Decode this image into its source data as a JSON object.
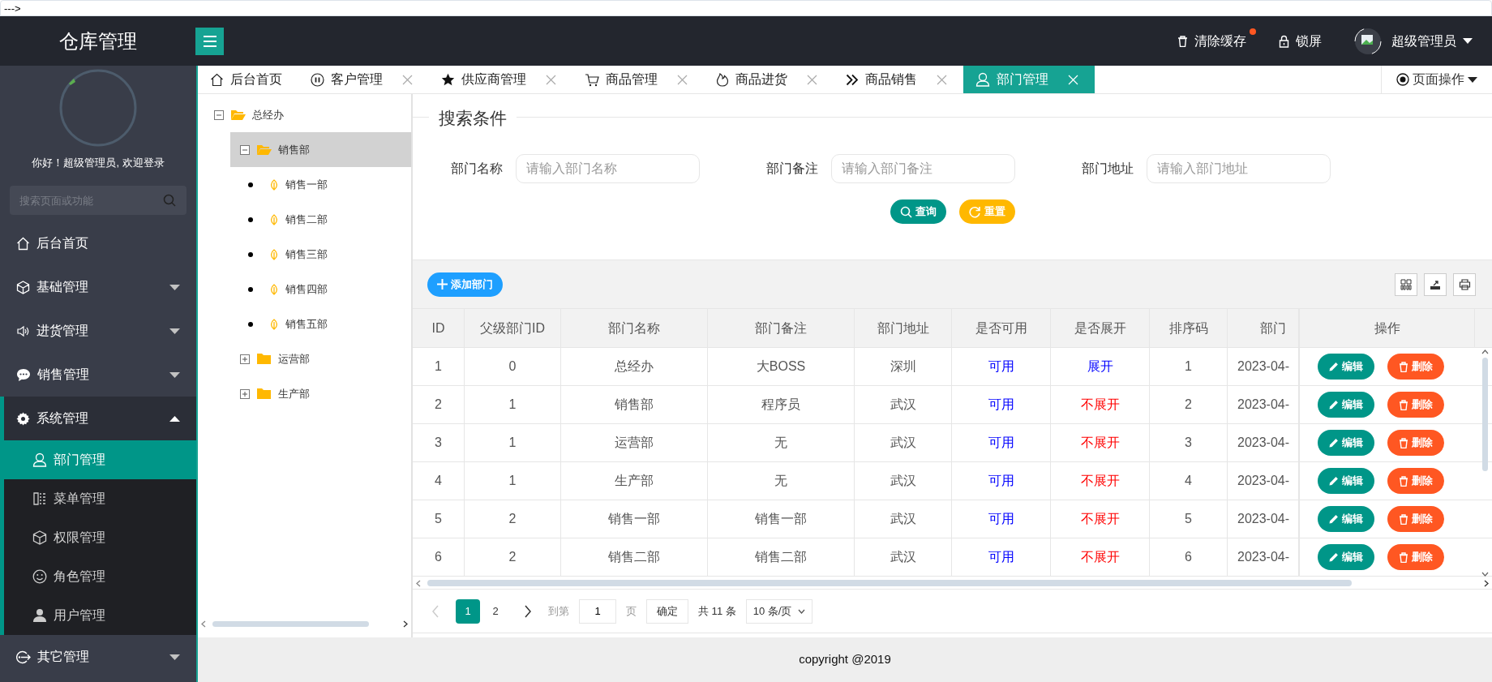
{
  "top_note": "--->",
  "header": {
    "logo": "仓库管理",
    "clear_cache": "清除缓存",
    "lock": "锁屏",
    "user": "超级管理员"
  },
  "sidebar": {
    "welcome": "你好！超级管理员, 欢迎登录",
    "search": {
      "placeholder": "搜索页面或功能"
    },
    "items": [
      {
        "kind": "link",
        "label": "后台首页"
      },
      {
        "kind": "group",
        "label": "基础管理",
        "expanded": false
      },
      {
        "kind": "group",
        "label": "进货管理",
        "expanded": false
      },
      {
        "kind": "group",
        "label": "销售管理",
        "expanded": false
      },
      {
        "kind": "group",
        "label": "系统管理",
        "expanded": true,
        "children": [
          {
            "label": "部门管理",
            "selected": true
          },
          {
            "label": "菜单管理",
            "selected": false
          },
          {
            "label": "权限管理",
            "selected": false
          },
          {
            "label": "角色管理",
            "selected": false
          },
          {
            "label": "用户管理",
            "selected": false
          }
        ]
      },
      {
        "kind": "group",
        "label": "其它管理",
        "expanded": false
      }
    ]
  },
  "tabs": [
    {
      "label": "后台首页",
      "selected": false,
      "closable": false
    },
    {
      "label": "客户管理",
      "selected": false,
      "closable": true
    },
    {
      "label": "供应商管理",
      "selected": false,
      "closable": true
    },
    {
      "label": "商品管理",
      "selected": false,
      "closable": true
    },
    {
      "label": "商品进货",
      "selected": false,
      "closable": true
    },
    {
      "label": "商品销售",
      "selected": false,
      "closable": true
    },
    {
      "label": "部门管理",
      "selected": true,
      "closable": true
    }
  ],
  "page_ops": "页面操作",
  "tree": [
    {
      "kind": "folder",
      "label": "总经办",
      "expanded": true,
      "selected": false,
      "children": [
        {
          "kind": "folder",
          "label": "销售部",
          "expanded": true,
          "selected": true,
          "children": [
            {
              "kind": "leaf",
              "label": "销售一部",
              "selected": false
            },
            {
              "kind": "leaf",
              "label": "销售二部",
              "selected": false
            },
            {
              "kind": "leaf",
              "label": "销售三部",
              "selected": false
            },
            {
              "kind": "leaf",
              "label": "销售四部",
              "selected": false
            },
            {
              "kind": "leaf",
              "label": "销售五部",
              "selected": false
            }
          ]
        },
        {
          "kind": "folder",
          "label": "运营部",
          "expanded": false,
          "selected": false
        },
        {
          "kind": "folder",
          "label": "生产部",
          "expanded": false,
          "selected": false
        }
      ]
    }
  ],
  "search": {
    "legend": "搜索条件",
    "fields": [
      {
        "label": "部门名称",
        "placeholder": "请输入部门名称"
      },
      {
        "label": "部门备注",
        "placeholder": "请输入部门备注"
      },
      {
        "label": "部门地址",
        "placeholder": "请输入部门地址"
      }
    ],
    "query_button": "查询",
    "reset_button": "重置"
  },
  "add_button": "添加部门",
  "table": {
    "columns": [
      "ID",
      "父级部门ID",
      "部门名称",
      "部门备注",
      "部门地址",
      "是否可用",
      "是否展开",
      "排序码",
      "部门",
      "操作"
    ],
    "rows": [
      {
        "id": "1",
        "pid": "0",
        "name": "总经办",
        "remark": "大BOSS",
        "address": "深圳",
        "available": "可用",
        "enabled": true,
        "open_text": "展开",
        "expanded": true,
        "order": "1",
        "created": "2023-04-",
        "edit": "编辑",
        "delete": "删除"
      },
      {
        "id": "2",
        "pid": "1",
        "name": "销售部",
        "remark": "程序员",
        "address": "武汉",
        "available": "可用",
        "enabled": true,
        "open_text": "不展开",
        "expanded": false,
        "order": "2",
        "created": "2023-04-",
        "edit": "编辑",
        "delete": "删除"
      },
      {
        "id": "3",
        "pid": "1",
        "name": "运营部",
        "remark": "无",
        "address": "武汉",
        "available": "可用",
        "enabled": true,
        "open_text": "不展开",
        "expanded": false,
        "order": "3",
        "created": "2023-04-",
        "edit": "编辑",
        "delete": "删除"
      },
      {
        "id": "4",
        "pid": "1",
        "name": "生产部",
        "remark": "无",
        "address": "武汉",
        "available": "可用",
        "enabled": true,
        "open_text": "不展开",
        "expanded": false,
        "order": "4",
        "created": "2023-04-",
        "edit": "编辑",
        "delete": "删除"
      },
      {
        "id": "5",
        "pid": "2",
        "name": "销售一部",
        "remark": "销售一部",
        "address": "武汉",
        "available": "可用",
        "enabled": true,
        "open_text": "不展开",
        "expanded": false,
        "order": "5",
        "created": "2023-04-",
        "edit": "编辑",
        "delete": "删除"
      },
      {
        "id": "6",
        "pid": "2",
        "name": "销售二部",
        "remark": "销售二部",
        "address": "武汉",
        "available": "可用",
        "enabled": true,
        "open_text": "不展开",
        "expanded": false,
        "order": "6",
        "created": "2023-04-",
        "edit": "编辑",
        "delete": "删除"
      }
    ]
  },
  "pagination": {
    "pages": [
      {
        "label": "1",
        "selected": true
      },
      {
        "label": "2",
        "selected": false
      }
    ],
    "goto_label": "到第",
    "goto_value": "1",
    "page_unit": "页",
    "confirm": "确定",
    "total": "共 11 条",
    "page_size": "10 条/页"
  },
  "footer": "copyright @2019"
}
